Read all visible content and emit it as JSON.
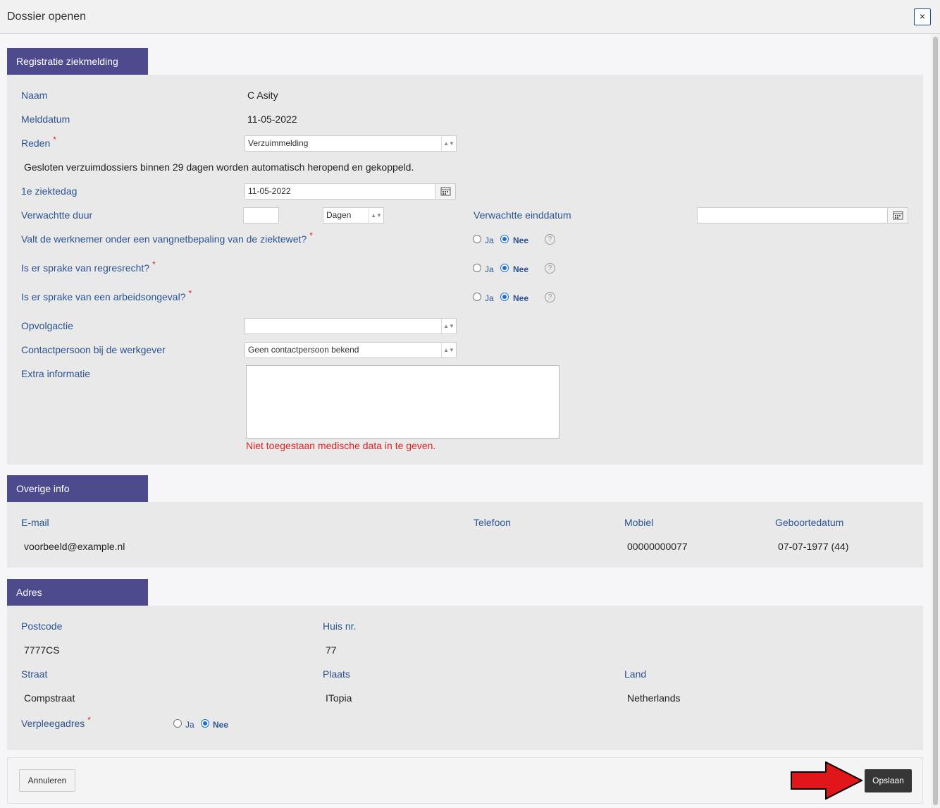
{
  "dialog": {
    "title": "Dossier openen",
    "close_label": "×"
  },
  "registratie": {
    "header": "Registratie ziekmelding",
    "naam_label": "Naam",
    "naam_value": "C Asity",
    "melddatum_label": "Melddatum",
    "melddatum_value": "11-05-2022",
    "reden_label": "Reden",
    "reden_value": "Verzuimmelding",
    "notice": "Gesloten verzuimdossiers binnen 29 dagen worden automatisch heropend en gekoppeld.",
    "ziektedag_label": "1e ziektedag",
    "ziektedag_value": "11-05-2022",
    "duur_label": "Verwachtte duur",
    "duur_value": "",
    "duur_unit": "Dagen",
    "einddatum_label": "Verwachtte einddatum",
    "einddatum_value": "",
    "vangnet_label": "Valt de werknemer onder een vangnetbepaling van de ziektewet?",
    "regres_label": "Is er sprake van regresrecht?",
    "arbeidsongeval_label": "Is er sprake van een arbeidsongeval?",
    "ja_label": "Ja",
    "nee_label": "Nee",
    "help_label": "?",
    "opvolgactie_label": "Opvolgactie",
    "opvolgactie_value": "",
    "contact_label": "Contactpersoon bij de werkgever",
    "contact_value": "Geen contactpersoon bekend",
    "extra_label": "Extra informatie",
    "extra_value": "",
    "warning": "Niet toegestaan medische data in te geven.",
    "required_mark": "*",
    "selected_option": "Nee"
  },
  "overige": {
    "header": "Overige info",
    "email_label": "E-mail",
    "email_value": "voorbeeld@example.nl",
    "telefoon_label": "Telefoon",
    "telefoon_value": "",
    "mobiel_label": "Mobiel",
    "mobiel_value": "00000000077",
    "geboorte_label": "Geboortedatum",
    "geboorte_value": "07-07-1977 (44)"
  },
  "adres": {
    "header": "Adres",
    "postcode_label": "Postcode",
    "postcode_value": "7777CS",
    "huisnr_label": "Huis nr.",
    "huisnr_value": "77",
    "straat_label": "Straat",
    "straat_value": "Compstraat",
    "plaats_label": "Plaats",
    "plaats_value": "ITopia",
    "land_label": "Land",
    "land_value": "Netherlands",
    "verpleeg_label": "Verpleegadres",
    "ja_label": "Ja",
    "nee_label": "Nee",
    "required_mark": "*",
    "selected_option": "Nee"
  },
  "footer": {
    "cancel_label": "Annuleren",
    "save_label": "Opslaan"
  },
  "colors": {
    "header_bg": "#4e4a8e",
    "label": "#2b5491",
    "required": "#e02020",
    "save_bg": "#363636",
    "arrow": "#e0161b"
  },
  "icons": {
    "close": "close-icon",
    "calendar": "calendar-icon",
    "help": "help-icon",
    "arrow": "red-arrow-icon"
  }
}
